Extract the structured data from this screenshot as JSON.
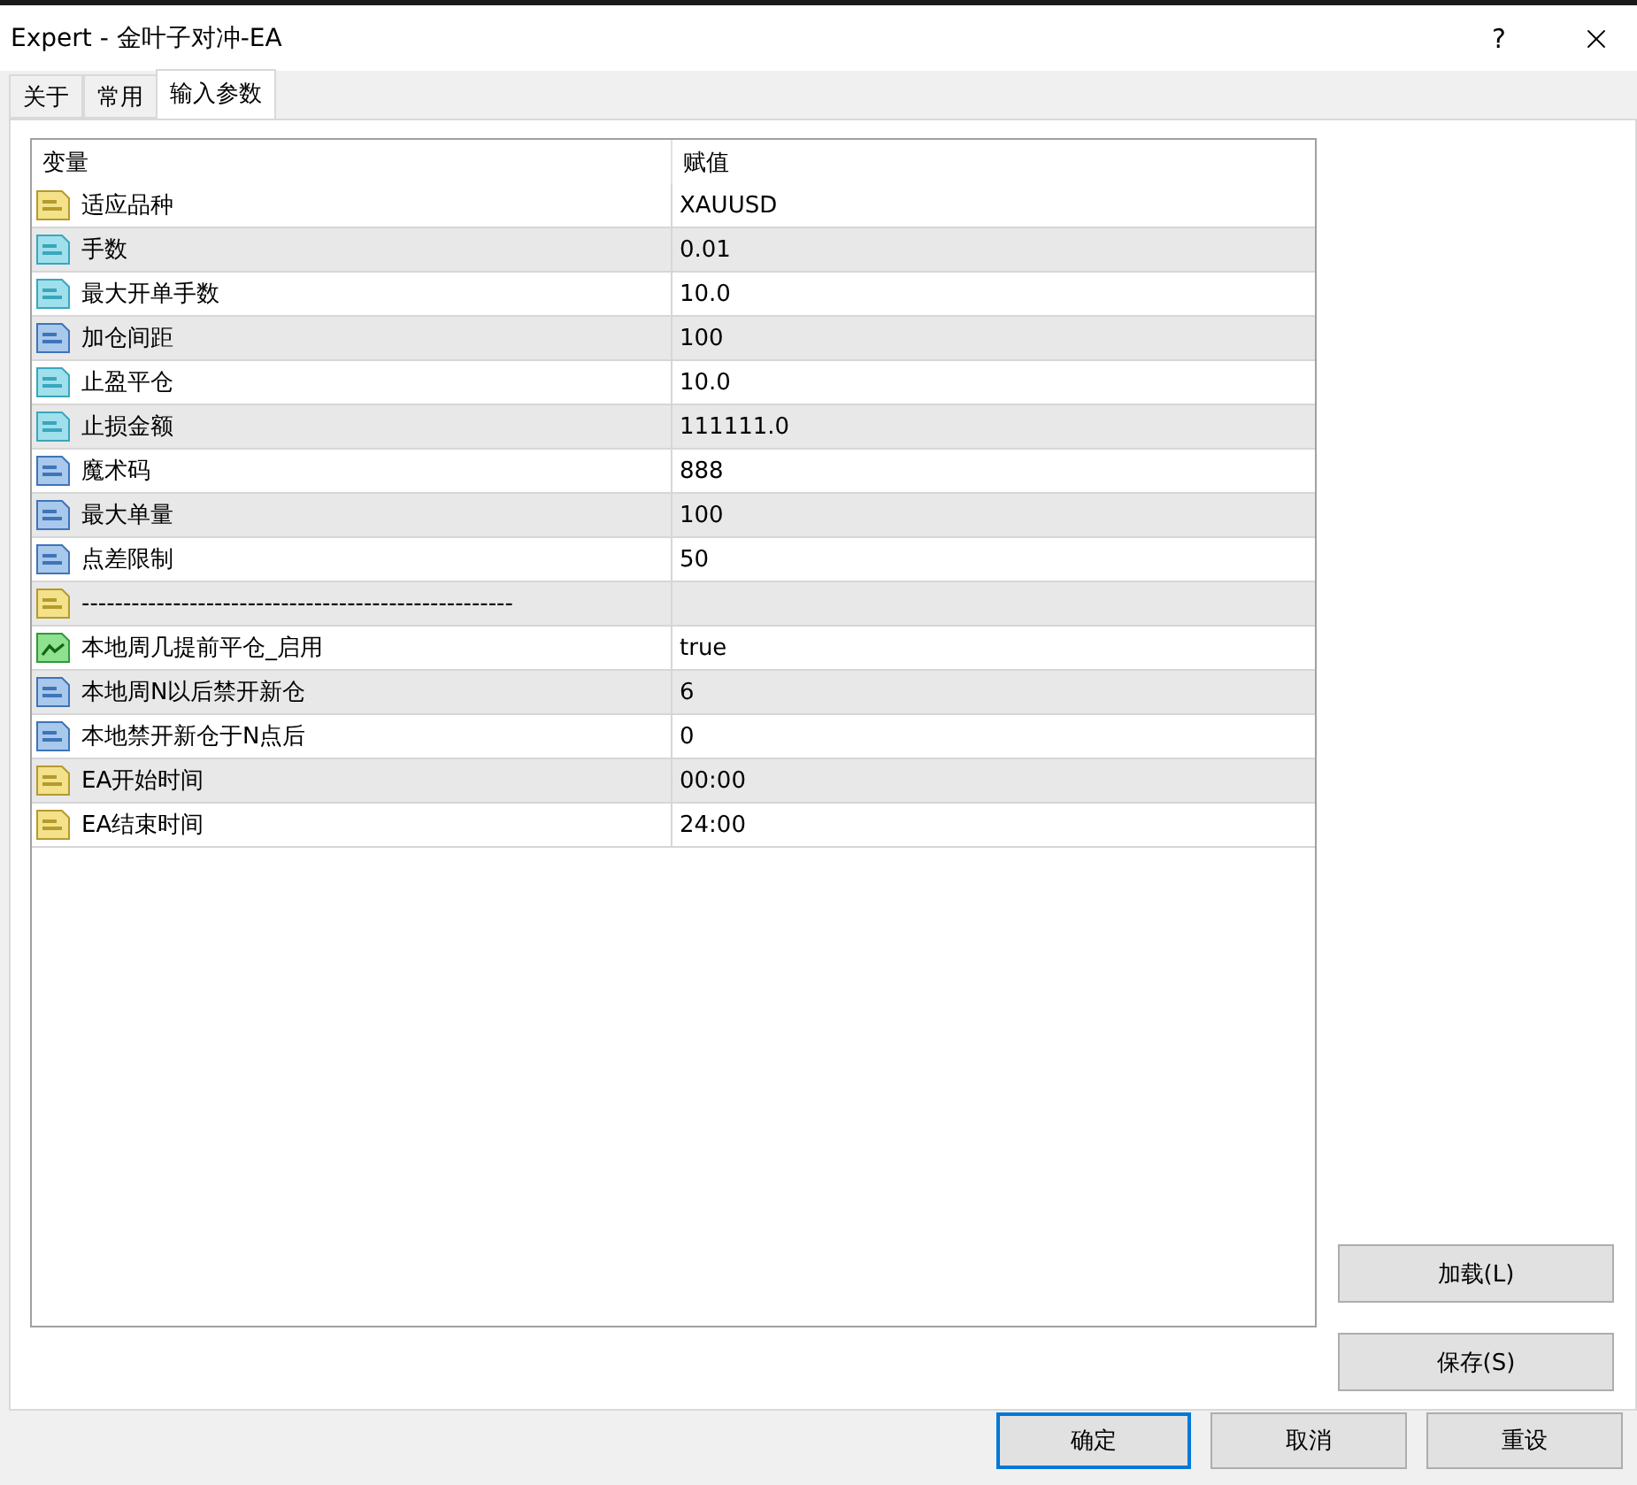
{
  "window": {
    "title": "Expert - 金叶子对冲-EA",
    "help": "?"
  },
  "tabs": [
    {
      "label": "关于",
      "selected": false
    },
    {
      "label": "常用",
      "selected": false
    },
    {
      "label": "输入参数",
      "selected": true
    }
  ],
  "table": {
    "columns": [
      "变量",
      "赋值"
    ],
    "rows": [
      {
        "kind": "string",
        "name": "适应品种",
        "value": "XAUUSD"
      },
      {
        "kind": "double",
        "name": "手数",
        "value": "0.01"
      },
      {
        "kind": "double",
        "name": "最大开单手数",
        "value": "10.0"
      },
      {
        "kind": "int",
        "name": "加仓间距",
        "value": "100"
      },
      {
        "kind": "double",
        "name": "止盈平仓",
        "value": "10.0"
      },
      {
        "kind": "double",
        "name": "止损金额",
        "value": "111111.0"
      },
      {
        "kind": "int",
        "name": "魔术码",
        "value": "888"
      },
      {
        "kind": "int",
        "name": "最大单量",
        "value": "100"
      },
      {
        "kind": "int",
        "name": "点差限制",
        "value": "50"
      },
      {
        "kind": "string",
        "name": "----------------------------------------------------",
        "value": ""
      },
      {
        "kind": "bool",
        "name": "本地周几提前平仓_启用",
        "value": "true"
      },
      {
        "kind": "int",
        "name": "本地周N以后禁开新仓",
        "value": "6"
      },
      {
        "kind": "int",
        "name": "本地禁开新仓于N点后",
        "value": "0"
      },
      {
        "kind": "string",
        "name": "EA开始时间",
        "value": "00:00"
      },
      {
        "kind": "string",
        "name": "EA结束时间",
        "value": "24:00"
      }
    ]
  },
  "side_buttons": [
    "加载(L)",
    "保存(S)"
  ],
  "footer_buttons": [
    {
      "label": "确定",
      "default": true
    },
    {
      "label": "取消",
      "default": false
    },
    {
      "label": "重设",
      "default": false
    }
  ]
}
